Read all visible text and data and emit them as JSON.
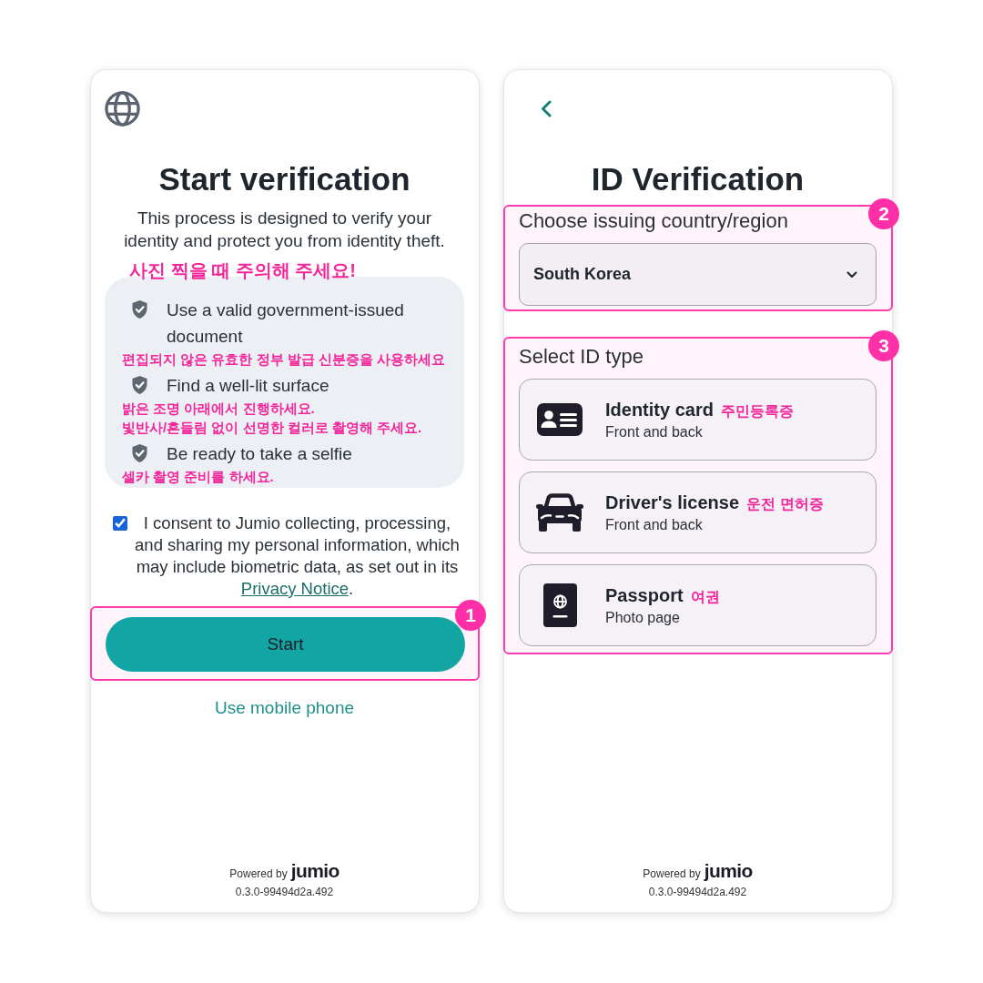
{
  "start_screen": {
    "title": "Start verification",
    "description": "This process is designed to verify your identity and protect you from identity theft.",
    "tips_note": "사진 찍을 때 주의해 주세요!",
    "tips": [
      {
        "text": "Use a valid government-issued document",
        "notes": [
          "편집되지 않은 유효한 정부 발급 신분증을 사용하세요"
        ]
      },
      {
        "text": "Find a well-lit surface",
        "notes": [
          "밝은 조명 아래에서 진행하세요.",
          "빛반사/흔들림 없이 선명한 컬러로 촬영해 주세요."
        ]
      },
      {
        "text": "Be ready to take a selfie",
        "notes": [
          "셀카 촬영 준비를 하세요."
        ]
      }
    ],
    "consent": {
      "checked": true,
      "text": "I consent to Jumio collecting, processing, and sharing my personal information, which may include biometric data, as set out in its",
      "link": "Privacy Notice",
      "end": "."
    },
    "start_callout": "1",
    "start_button": "Start",
    "mobile_link": "Use mobile phone",
    "footer": {
      "powered_by": "Powered by",
      "logo": "jumio",
      "version": "0.3.0-99494d2a.492"
    }
  },
  "id_screen": {
    "title": "ID Verification",
    "country_callout": "2",
    "country_label": "Choose issuing country/region",
    "country_value": "South Korea",
    "id_callout": "3",
    "id_label": "Select ID type",
    "id_types": [
      {
        "kind": "identity_card",
        "title": "Identity card",
        "note": "주민등록증",
        "subtitle": "Front and back"
      },
      {
        "kind": "drivers_license",
        "title": "Driver's license",
        "note": "운전 면허증",
        "subtitle": "Front and back"
      },
      {
        "kind": "passport",
        "title": "Passport",
        "note": "여권",
        "subtitle": "Photo page"
      }
    ],
    "footer": {
      "powered_by": "Powered by",
      "logo": "jumio",
      "version": "0.3.0-99494d2a.492"
    }
  }
}
